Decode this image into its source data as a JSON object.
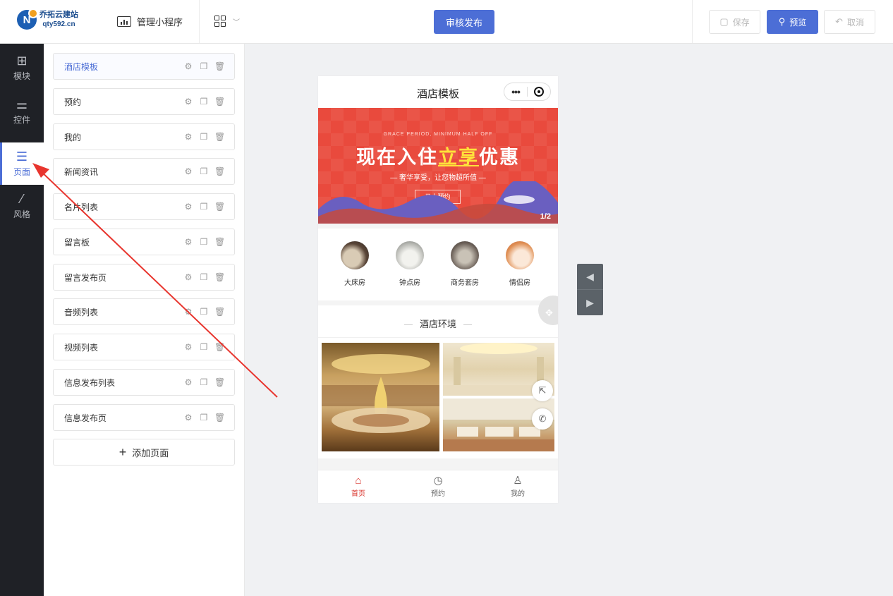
{
  "header": {
    "logo_name": "乔拓云建站",
    "logo_url": "qty592.cn",
    "manage_label": "管理小程序",
    "publish_label": "审核发布",
    "save_label": "保存",
    "preview_label": "预览",
    "cancel_label": "取消"
  },
  "sidebar": {
    "items": [
      {
        "label": "模块",
        "icon": "plus-square-icon"
      },
      {
        "label": "控件",
        "icon": "sliders-icon"
      },
      {
        "label": "页面",
        "icon": "pages-icon"
      },
      {
        "label": "风格",
        "icon": "magic-wand-icon"
      }
    ],
    "active": "页面"
  },
  "pages": {
    "items": [
      {
        "label": "酒店模板"
      },
      {
        "label": "预约"
      },
      {
        "label": "我的"
      },
      {
        "label": "新闻资讯"
      },
      {
        "label": "名片列表"
      },
      {
        "label": "留言板"
      },
      {
        "label": "留言发布页"
      },
      {
        "label": "音频列表"
      },
      {
        "label": "视频列表"
      },
      {
        "label": "信息发布列表"
      },
      {
        "label": "信息发布页"
      }
    ],
    "add_label": "添加页面"
  },
  "phone": {
    "title": "酒店模板",
    "banner": {
      "small": "GRACE PERIOD, MINIMUM HALF OFF",
      "big_a": "现在入住",
      "big_b": "立享",
      "big_c": "优惠",
      "sub": "奢华享受，让您物超所值",
      "button": "马上预约",
      "pager": "1/2"
    },
    "rooms": [
      {
        "label": "大床房"
      },
      {
        "label": "钟点房"
      },
      {
        "label": "商务套房"
      },
      {
        "label": "情侣房"
      }
    ],
    "section_title": "酒店环境",
    "tabs": [
      {
        "label": "首页",
        "icon": "home-icon"
      },
      {
        "label": "预约",
        "icon": "clock-icon"
      },
      {
        "label": "我的",
        "icon": "user-icon"
      }
    ]
  },
  "colors": {
    "accent": "#4c6ed6",
    "banner": "#e94a3d",
    "sidebar_bg": "#1f2126",
    "tab_active": "#d9332b",
    "annotation_arrow": "#e8352e"
  }
}
